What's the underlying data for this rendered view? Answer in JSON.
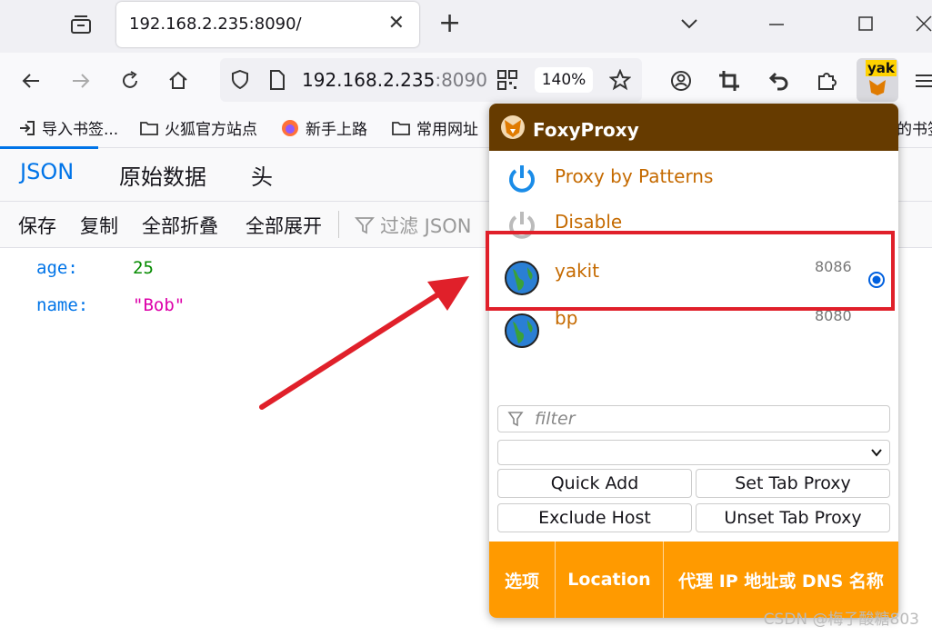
{
  "browser": {
    "tab_title": "192.168.2.235:8090/",
    "tab_close": "✕",
    "new_tab": "+",
    "url_host": "192.168.2.235",
    "url_port": ":8090",
    "zoom": "140%",
    "extension_badge": "yak"
  },
  "bookmarks": [
    {
      "label": "导入书签...",
      "icon": "import-icon"
    },
    {
      "label": "火狐官方站点",
      "icon": "folder-icon"
    },
    {
      "label": "新手上路",
      "icon": "firefox-icon"
    },
    {
      "label": "常用网址",
      "icon": "folder-icon"
    },
    {
      "label": "的书签",
      "icon": "folder-icon"
    }
  ],
  "json_viewer": {
    "tabs": [
      "JSON",
      "原始数据",
      "头"
    ],
    "toolbar": [
      "保存",
      "复制",
      "全部折叠",
      "全部展开"
    ],
    "filter_placeholder": "过滤 JSON",
    "rows": [
      {
        "key": "age:",
        "value": "25"
      },
      {
        "key": "name:",
        "value": "\"Bob\""
      }
    ]
  },
  "foxyproxy": {
    "title": "FoxyProxy",
    "modes": [
      "Proxy by Patterns",
      "Disable"
    ],
    "proxies": [
      {
        "name": "yakit",
        "port": "8086",
        "selected": true
      },
      {
        "name": "bp",
        "port": "8080",
        "selected": false
      }
    ],
    "filter_placeholder": "filter",
    "buttons": {
      "quick_add": "Quick Add",
      "set_tab_proxy": "Set Tab Proxy",
      "exclude_host": "Exclude Host",
      "unset_tab_proxy": "Unset Tab Proxy"
    },
    "footer": {
      "options": "选项",
      "location": "Location",
      "proxy_ip": "代理 IP 地址或 DNS 名称"
    }
  },
  "watermark": "CSDN @梅子酸糖803",
  "colors": {
    "accent_blue": "#0074e8",
    "foxy_brown": "#663b00",
    "foxy_orange": "#ff9a00",
    "highlight_red": "#e0202a"
  }
}
